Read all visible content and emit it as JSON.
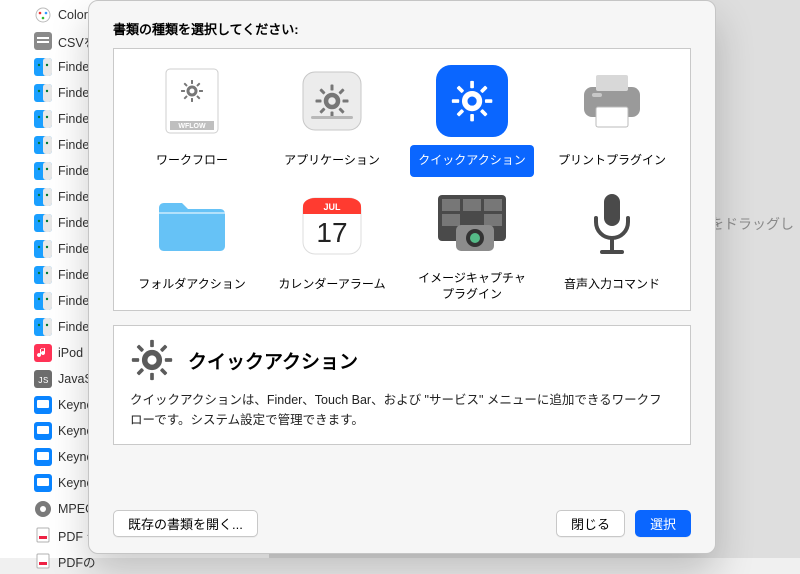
{
  "background": {
    "items": [
      {
        "label": "ColorSync",
        "icon": "palette"
      },
      {
        "label": "CSVを",
        "icon": "csv"
      },
      {
        "label": "Finde",
        "icon": "finder"
      },
      {
        "label": "Finde",
        "icon": "finder"
      },
      {
        "label": "Finde",
        "icon": "finder"
      },
      {
        "label": "Finde",
        "icon": "finder"
      },
      {
        "label": "Finde",
        "icon": "finder"
      },
      {
        "label": "Finde",
        "icon": "finder"
      },
      {
        "label": "Finde",
        "icon": "finder"
      },
      {
        "label": "Finde",
        "icon": "finder"
      },
      {
        "label": "Finde",
        "icon": "finder"
      },
      {
        "label": "Finde",
        "icon": "finder"
      },
      {
        "label": "Finde",
        "icon": "finder"
      },
      {
        "label": "iPod ",
        "icon": "music"
      },
      {
        "label": "JavaS",
        "icon": "script"
      },
      {
        "label": "Keyno",
        "icon": "keynote"
      },
      {
        "label": "Keyno",
        "icon": "keynote"
      },
      {
        "label": "Keyno",
        "icon": "keynote"
      },
      {
        "label": "Keyno",
        "icon": "keynote"
      },
      {
        "label": "MPEG",
        "icon": "media"
      },
      {
        "label": "PDF テ",
        "icon": "pdf"
      },
      {
        "label": "PDFの",
        "icon": "pdf"
      }
    ],
    "hint_text": "イルをドラッグし"
  },
  "dialog": {
    "title": "書類の種類を選択してください:",
    "options": [
      {
        "id": "workflow",
        "label": "ワークフロー",
        "icon": "wflow",
        "selected": false
      },
      {
        "id": "application",
        "label": "アプリケーション",
        "icon": "app",
        "selected": false
      },
      {
        "id": "quickaction",
        "label": "クイックアクション",
        "icon": "gear-blue",
        "selected": true
      },
      {
        "id": "printplugin",
        "label": "プリントプラグイン",
        "icon": "printer",
        "selected": false
      },
      {
        "id": "folderaction",
        "label": "フォルダアクション",
        "icon": "folder",
        "selected": false
      },
      {
        "id": "calendaralarm",
        "label": "カレンダーアラーム",
        "icon": "calendar",
        "selected": false
      },
      {
        "id": "imagecapture",
        "label": "イメージキャプチャ\nプラグイン",
        "icon": "capture",
        "selected": false
      },
      {
        "id": "dictation",
        "label": "音声入力コマンド",
        "icon": "mic",
        "selected": false
      }
    ],
    "calendar_day": "17",
    "calendar_month": "JUL",
    "detail": {
      "title": "クイックアクション",
      "desc": "クイックアクションは、Finder、Touch Bar、および \"サービス\" メニューに追加できるワークフローです。システム設定で管理できます。"
    },
    "buttons": {
      "open_existing": "既存の書類を開く...",
      "close": "閉じる",
      "choose": "選択"
    }
  }
}
